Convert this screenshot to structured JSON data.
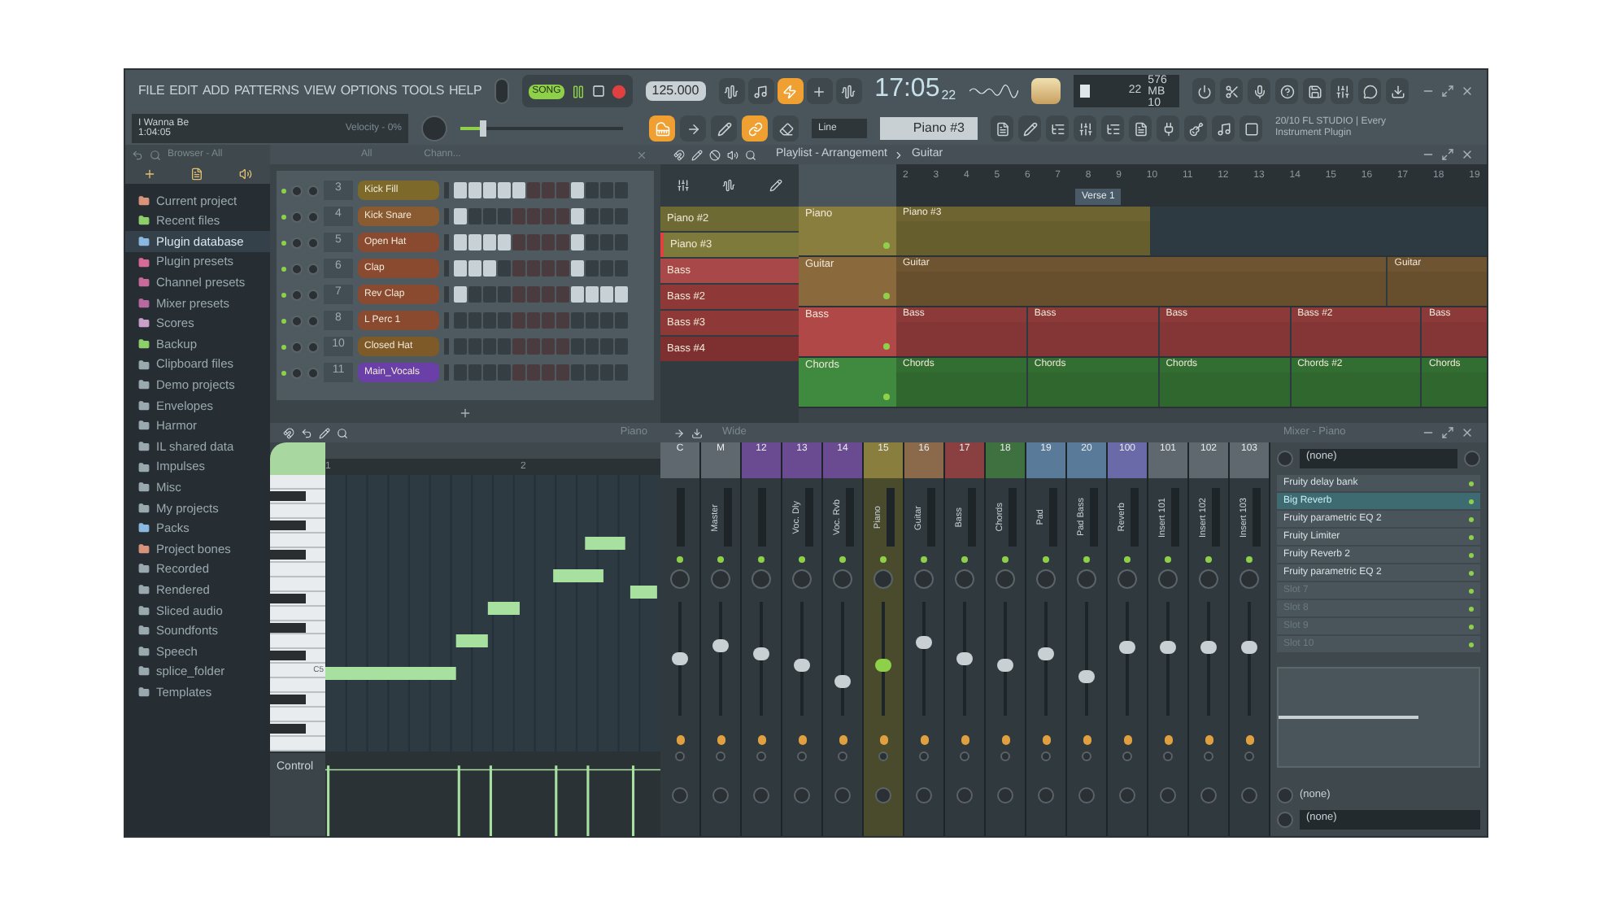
{
  "menu": [
    "FILE",
    "EDIT",
    "ADD",
    "PATTERNS",
    "VIEW",
    "OPTIONS",
    "TOOLS",
    "HELP"
  ],
  "transport": {
    "mode": "SONG",
    "tempo": "125.000"
  },
  "clock": {
    "time": "17:05",
    "sub": "22"
  },
  "monitor": {
    "cpu": "22",
    "memory": "576 MB",
    "polyphony": "10"
  },
  "hint": {
    "title": "I Wanna Be",
    "time": "1:04:05",
    "message": "Velocity - 0%"
  },
  "master_pitch": {
    "level": 0.12
  },
  "record_buttons": [
    {
      "on": false
    },
    {
      "on": false
    },
    {
      "on": true
    },
    {
      "on": false
    },
    {
      "on": false
    }
  ],
  "tool_buttons": [
    {
      "on": true
    },
    {
      "on": false
    },
    {
      "on": false
    },
    {
      "on": true
    },
    {
      "on": false
    }
  ],
  "snap": "Line",
  "pattern": "Piano #3",
  "news": "20/10  FL STUDIO | Every Instrument Plugin",
  "browser": {
    "title": "Browser - All",
    "items": [
      {
        "label": "Current project",
        "color": "#d8937a",
        "selected": false
      },
      {
        "label": "Recent files",
        "color": "#8fcf6a",
        "selected": false
      },
      {
        "label": "Plugin database",
        "color": "#8ab8e0",
        "selected": true
      },
      {
        "label": "Plugin presets",
        "color": "#d86a9a",
        "selected": false
      },
      {
        "label": "Channel presets",
        "color": "#c86a9a",
        "selected": false
      },
      {
        "label": "Mixer presets",
        "color": "#b86aa0",
        "selected": false
      },
      {
        "label": "Scores",
        "color": "#c8a0c8",
        "selected": false
      },
      {
        "label": "Backup",
        "color": "#8fcf6a",
        "selected": false
      },
      {
        "label": "Clipboard files",
        "color": "#9aa8b0",
        "selected": false
      },
      {
        "label": "Demo projects",
        "color": "#9aa8b0",
        "selected": false
      },
      {
        "label": "Envelopes",
        "color": "#9aa8b0",
        "selected": false
      },
      {
        "label": "Harmor",
        "color": "#9aa8b0",
        "selected": false
      },
      {
        "label": "IL shared data",
        "color": "#9aa8b0",
        "selected": false
      },
      {
        "label": "Impulses",
        "color": "#9aa8b0",
        "selected": false
      },
      {
        "label": "Misc",
        "color": "#9aa8b0",
        "selected": false
      },
      {
        "label": "My projects",
        "color": "#9aa8b0",
        "selected": false
      },
      {
        "label": "Packs",
        "color": "#8ab8e0",
        "selected": false
      },
      {
        "label": "Project bones",
        "color": "#d8937a",
        "selected": false
      },
      {
        "label": "Recorded",
        "color": "#9aa8b0",
        "selected": false
      },
      {
        "label": "Rendered",
        "color": "#9aa8b0",
        "selected": false
      },
      {
        "label": "Sliced audio",
        "color": "#9aa8b0",
        "selected": false
      },
      {
        "label": "Soundfonts",
        "color": "#9aa8b0",
        "selected": false
      },
      {
        "label": "Speech",
        "color": "#9aa8b0",
        "selected": false
      },
      {
        "label": "splice_folder",
        "color": "#9aa8b0",
        "selected": false
      },
      {
        "label": "Templates",
        "color": "#9aa8b0",
        "selected": false
      }
    ]
  },
  "channel_rack": {
    "filter": "All",
    "title": "Chann...",
    "channels": [
      {
        "number": "3",
        "name": "Kick Fill",
        "color": "#7d6a2a",
        "steps": [
          true,
          true,
          true,
          true,
          true,
          false,
          false,
          false,
          true,
          false,
          false,
          false
        ]
      },
      {
        "number": "4",
        "name": "Kick Snare",
        "color": "#8a5a30",
        "steps": [
          true,
          false,
          false,
          false,
          false,
          false,
          false,
          false,
          true,
          false,
          false,
          false
        ]
      },
      {
        "number": "5",
        "name": "Open Hat",
        "color": "#8a4a30",
        "steps": [
          true,
          true,
          true,
          true,
          false,
          false,
          false,
          false,
          true,
          false,
          false,
          false
        ]
      },
      {
        "number": "6",
        "name": "Clap",
        "color": "#8a4a30",
        "steps": [
          true,
          true,
          true,
          false,
          false,
          false,
          false,
          false,
          true,
          false,
          false,
          false
        ]
      },
      {
        "number": "7",
        "name": "Rev Clap",
        "color": "#8a4a30",
        "steps": [
          true,
          false,
          false,
          false,
          false,
          false,
          false,
          false,
          true,
          true,
          true,
          true
        ]
      },
      {
        "number": "8",
        "name": "L Perc 1",
        "color": "#8a4a30",
        "steps": [
          false,
          false,
          false,
          false,
          false,
          false,
          false,
          false,
          false,
          false,
          false,
          false
        ]
      },
      {
        "number": "10",
        "name": "Closed Hat",
        "color": "#7d5a28",
        "steps": [
          false,
          false,
          false,
          false,
          false,
          false,
          false,
          false,
          false,
          false,
          false,
          false
        ]
      },
      {
        "number": "11",
        "name": "Main_Vocals",
        "color": "#6a3fa8",
        "steps": [
          false,
          false,
          false,
          false,
          false,
          false,
          false,
          false,
          false,
          false,
          false,
          false
        ]
      }
    ]
  },
  "playlist": {
    "title": "Playlist - Arrangement",
    "breadcrumb": "Guitar",
    "patterns": [
      {
        "name": "Piano #2",
        "color": "#6e6a34",
        "selected": false
      },
      {
        "name": "Piano #3",
        "color": "#7e7a3c",
        "selected": true
      },
      {
        "name": "Bass",
        "color": "#a84848",
        "selected": false
      },
      {
        "name": "Bass #2",
        "color": "#8e3838",
        "selected": false
      },
      {
        "name": "Bass #3",
        "color": "#8e3838",
        "selected": false
      },
      {
        "name": "Bass #4",
        "color": "#7e3030",
        "selected": false
      }
    ],
    "bars": [
      "2",
      "3",
      "4",
      "5",
      "6",
      "7",
      "8",
      "9",
      "10",
      "11",
      "12",
      "13",
      "14",
      "15",
      "16",
      "17",
      "18",
      "19"
    ],
    "marker": "Verse 1",
    "tracks": [
      {
        "name": "Piano",
        "color": "#8a7e3e",
        "clips": [
          "Piano #3"
        ]
      },
      {
        "name": "Guitar",
        "color": "#8a6a3c",
        "clips": [
          "Guitar",
          "Guitar"
        ]
      },
      {
        "name": "Bass",
        "color": "#b04848",
        "clips": [
          "Bass",
          "Bass",
          "Bass",
          "Bass #2",
          "Bass"
        ]
      },
      {
        "name": "Chords",
        "color": "#3f8a3f",
        "clips": [
          "Chords",
          "Chords",
          "Chords",
          "Chords #2",
          "Chords"
        ]
      }
    ]
  },
  "piano_roll": {
    "title": "Piano",
    "bars": [
      "1",
      "2"
    ],
    "key_label": "C5",
    "control": "Control"
  },
  "mixer": {
    "preset": "Wide",
    "tracks": [
      {
        "number": "C",
        "color": "#5e686e",
        "level": 0.5,
        "selected": false
      },
      {
        "number": "M",
        "name": "Master",
        "color": "#5e686e",
        "level": 0.62,
        "selected": false
      },
      {
        "number": "12",
        "color": "#6a4a90",
        "level": 0.55,
        "selected": false
      },
      {
        "number": "13",
        "name": "Voc. Dly",
        "color": "#6a4a90",
        "level": 0.45,
        "selected": false
      },
      {
        "number": "14",
        "name": "Voc. Rvb",
        "color": "#6a4a90",
        "level": 0.3,
        "selected": false
      },
      {
        "number": "15",
        "name": "Piano",
        "color": "#8a7e3e",
        "level": 0.45,
        "selected": true
      },
      {
        "number": "16",
        "name": "Guitar",
        "color": "#8a6a4a",
        "level": 0.65,
        "selected": false
      },
      {
        "number": "17",
        "name": "Bass",
        "color": "#8a4040",
        "level": 0.5,
        "selected": false
      },
      {
        "number": "18",
        "name": "Chords",
        "color": "#3f7040",
        "level": 0.45,
        "selected": false
      },
      {
        "number": "19",
        "name": "Pad",
        "color": "#5a7a9a",
        "level": 0.55,
        "selected": false
      },
      {
        "number": "20",
        "name": "Pad Bass",
        "color": "#5a7a9a",
        "level": 0.35,
        "selected": false
      },
      {
        "number": "100",
        "name": "Reverb",
        "color": "#6a6aa8",
        "level": 0.6,
        "selected": false
      },
      {
        "number": "101",
        "name": "Insert 101",
        "color": "#5e686e",
        "level": 0.6,
        "selected": false
      },
      {
        "number": "102",
        "name": "Insert 102",
        "color": "#5e686e",
        "level": 0.6,
        "selected": false
      },
      {
        "number": "103",
        "name": "Insert 103",
        "color": "#5e686e",
        "level": 0.6,
        "selected": false
      }
    ],
    "inserts": {
      "title": "Mixer - Piano",
      "input": "(none)",
      "slots": [
        {
          "name": "Fruity delay bank",
          "kind": "effect",
          "selected": false
        },
        {
          "name": "Big Reverb",
          "kind": "effect",
          "selected": true
        },
        {
          "name": "Fruity parametric EQ 2",
          "kind": "effect",
          "selected": false
        },
        {
          "name": "Fruity Limiter",
          "kind": "effect",
          "selected": false
        },
        {
          "name": "Fruity Reverb 2",
          "kind": "effect",
          "selected": false
        },
        {
          "name": "Fruity parametric EQ 2",
          "kind": "effect",
          "selected": false
        },
        {
          "name": "Slot 7",
          "kind": "empty",
          "selected": false
        },
        {
          "name": "Slot 8",
          "kind": "empty",
          "selected": false
        },
        {
          "name": "Slot 9",
          "kind": "empty",
          "selected": false
        },
        {
          "name": "Slot 10",
          "kind": "empty",
          "selected": false
        }
      ],
      "output_top": "(none)",
      "output": "(none)"
    }
  }
}
